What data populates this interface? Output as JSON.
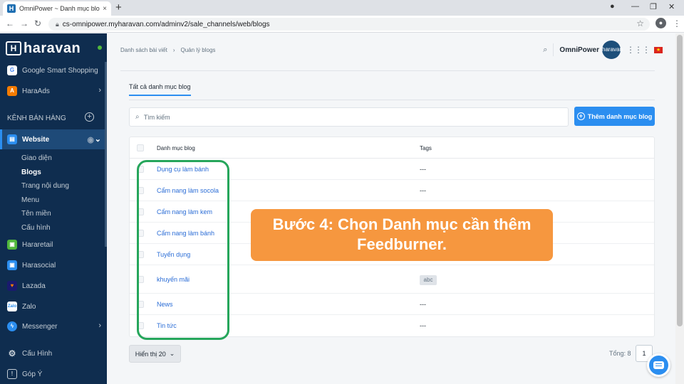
{
  "browser": {
    "tab_title": "OmniPower ~ Danh mục blogs ~ ...",
    "tab_close": "×",
    "new_tab": "+",
    "url": "cs-omnipower.myharavan.com/adminv2/sale_channels/web/blogs"
  },
  "sidebar": {
    "logo_text": "haravan",
    "items_top": [
      {
        "label": "Google Smart Shopping",
        "icon": "google-icon",
        "color": "#ffffff"
      },
      {
        "label": "HaraAds",
        "icon": "haraads-icon",
        "color": "#f57c00"
      }
    ],
    "section_title": "KÊNH BÁN HÀNG",
    "website_label": "Website",
    "website_sub": [
      "Giao diện",
      "Blogs",
      "Trang nội dung",
      "Menu",
      "Tên miền",
      "Cấu hình"
    ],
    "channels": [
      {
        "label": "Hararetail",
        "icon": "hararetail-icon",
        "color": "#50b83c"
      },
      {
        "label": "Harasocial",
        "icon": "harasocial-icon",
        "color": "#2b8ef0"
      },
      {
        "label": "Lazada",
        "icon": "lazada-icon",
        "color": "#1a1a6e"
      },
      {
        "label": "Zalo",
        "icon": "zalo-icon",
        "color": "#ffffff"
      },
      {
        "label": "Messenger",
        "icon": "messenger-icon",
        "color": "#2b8ef0"
      }
    ],
    "bottom": [
      {
        "label": "Cấu Hình",
        "icon": "settings-icon"
      },
      {
        "label": "Góp Ý",
        "icon": "feedback-icon"
      }
    ]
  },
  "header": {
    "breadcrumb": [
      "Danh sách bài viết",
      "Quản lý blogs"
    ],
    "shop_name": "OmniPower",
    "avatar_text": "haravan"
  },
  "main": {
    "tab_label": "Tất cả danh mục blog",
    "search_placeholder": "Tìm kiếm",
    "add_button": "Thêm danh mục blog",
    "table": {
      "col_name": "Danh mục blog",
      "col_tags": "Tags",
      "rows": [
        {
          "name": "Dụng cụ làm bánh",
          "tags": "---"
        },
        {
          "name": "Cẩm nang làm socola",
          "tags": "---"
        },
        {
          "name": "Cẩm nang làm kem",
          "tags": ""
        },
        {
          "name": "Cẩm nang làm bánh",
          "tags": ""
        },
        {
          "name": "Tuyển dụng",
          "tags": ""
        },
        {
          "name": "khuyến mãi",
          "tags": "abc"
        },
        {
          "name": "News",
          "tags": "---"
        },
        {
          "name": "Tin tức",
          "tags": "---"
        }
      ]
    },
    "show_label": "Hiển thị 20",
    "total_label": "Tổng: 8",
    "page": "1"
  },
  "annotation": {
    "callout": "Bước 4: Chọn Danh mục cần thêm Feedburner.",
    "box_color": "#26a65b",
    "callout_color": "#f6973f"
  }
}
